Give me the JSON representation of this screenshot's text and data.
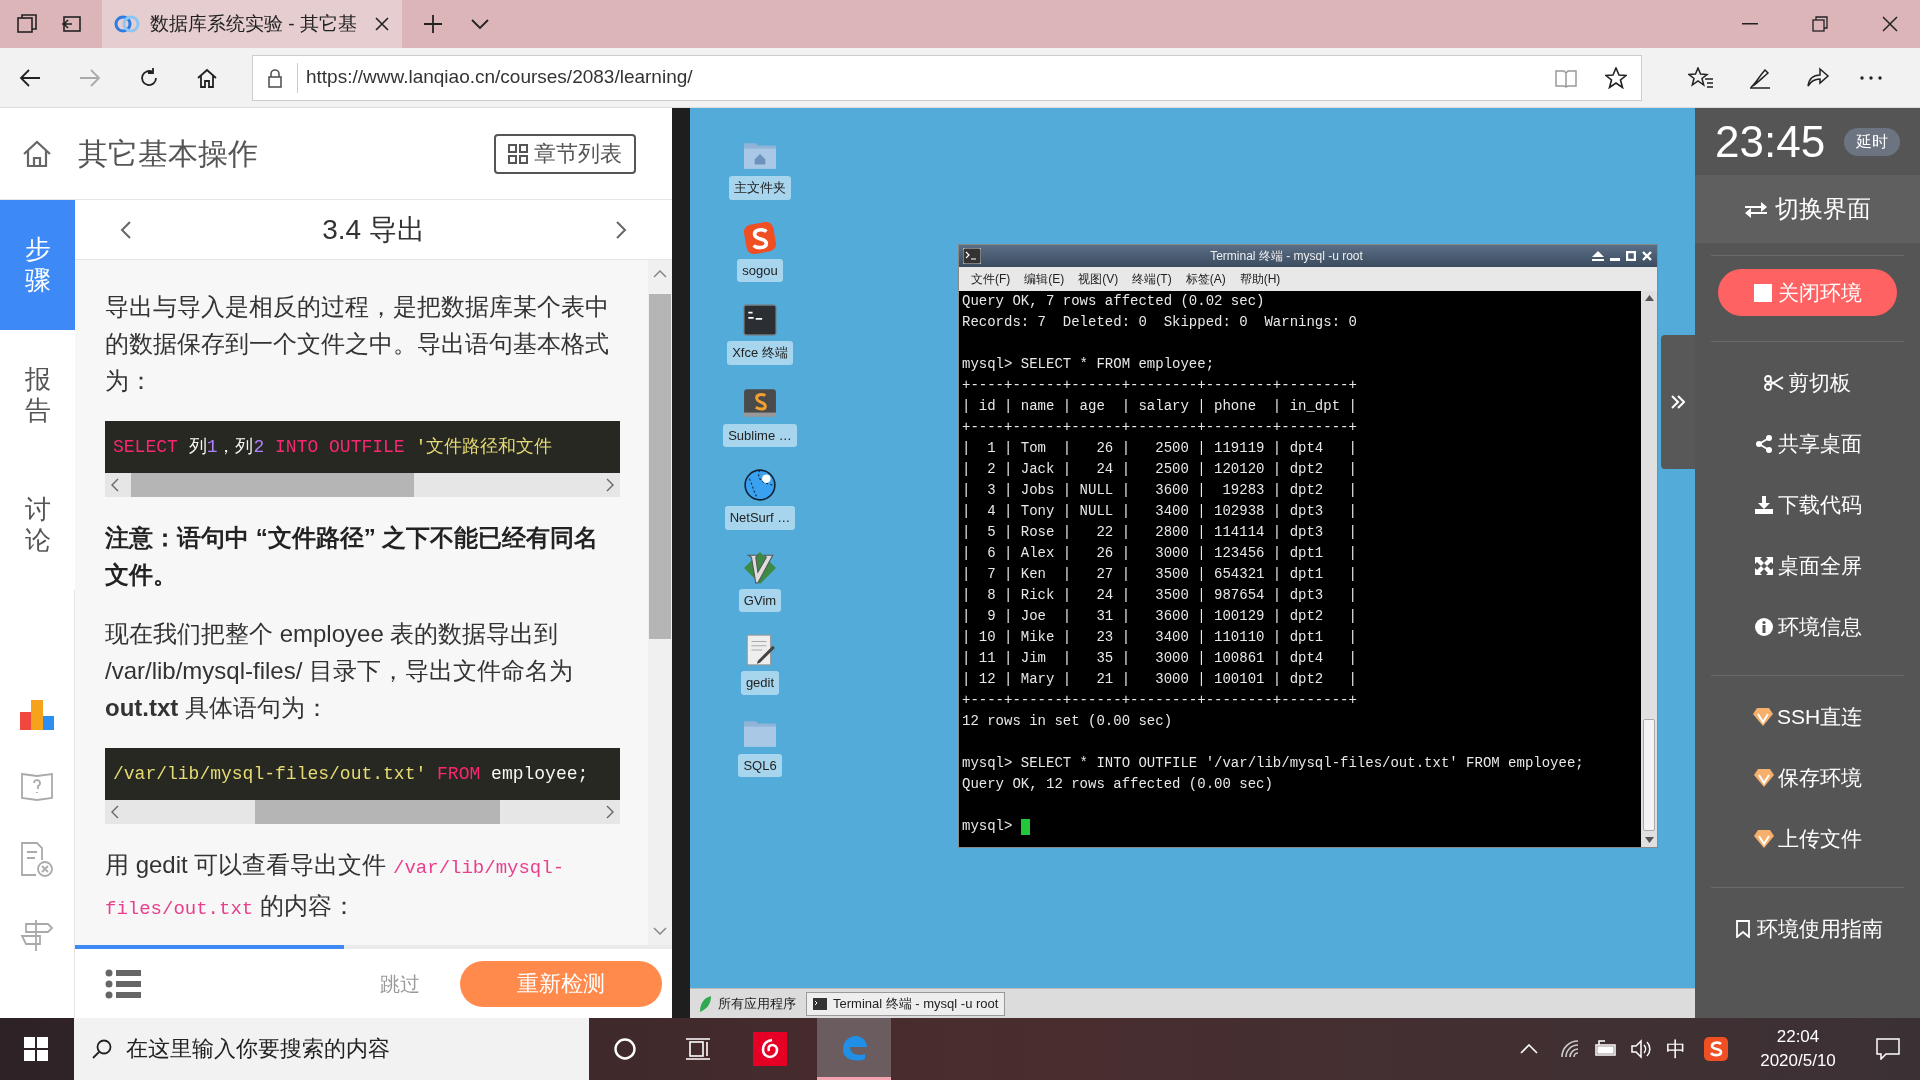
{
  "browser": {
    "tab_title": "数据库系统实验 - 其它基",
    "url": "https://www.lanqiao.cn/courses/2083/learning/"
  },
  "lesson": {
    "title": "其它基本操作",
    "chapter_button": "章节列表",
    "nav": [
      {
        "label": "步骤",
        "selected": true
      },
      {
        "label": "报告",
        "selected": false
      },
      {
        "label": "讨论",
        "selected": false
      }
    ],
    "section_title": "3.4 导出",
    "blocks": [
      {
        "kind": "paragraph",
        "text": "导出与导入是相反的过程，是把数据库某个表中的数据保存到一个文件之中。导出语句基本格式为："
      },
      {
        "kind": "code",
        "tokens": [
          {
            "kind": "keyword",
            "text": "SELECT"
          },
          {
            "kind": "text",
            "text": " 列"
          },
          {
            "kind": "number",
            "text": "1"
          },
          {
            "kind": "text",
            "text": "，列"
          },
          {
            "kind": "number",
            "text": "2"
          },
          {
            "kind": "keyword",
            "text": " INTO OUTFILE "
          },
          {
            "kind": "string",
            "text": "'文件路径和文件"
          }
        ]
      },
      {
        "kind": "note",
        "text": "注意：语句中 “文件路径” 之下不能已经有同名文件。"
      },
      {
        "kind": "paragraph",
        "text": "现在我们把整个 employee 表的数据导出到 /var/lib/mysql-files/ 目录下，导出文件命名为 **out.txt** 具体语句为："
      },
      {
        "kind": "code",
        "tokens": [
          {
            "kind": "string",
            "text": "/var/lib/mysql-files/out.txt'"
          },
          {
            "kind": "keyword",
            "text": " FROM "
          },
          {
            "kind": "text",
            "text": "employee;"
          }
        ]
      },
      {
        "kind": "mixed",
        "segments": [
          {
            "kind": "text",
            "text": "用 gedit 可以查看导出文件 "
          },
          {
            "kind": "code",
            "text": "/var/lib/mysql-files/out.txt"
          },
          {
            "kind": "text",
            "text": " 的内容："
          }
        ]
      }
    ],
    "progress": {
      "level": 0.45
    },
    "skip": "跳过",
    "recheck": "重新检测"
  },
  "desktop": {
    "icons": [
      {
        "kind": "home",
        "label": "主文件夹"
      },
      {
        "kind": "sogou",
        "label": "sogou"
      },
      {
        "kind": "terminal",
        "label": "Xfce 终端"
      },
      {
        "kind": "sublime",
        "label": "Sublime …"
      },
      {
        "kind": "globe",
        "label": "NetSurf …"
      },
      {
        "kind": "vim",
        "label": "GVim"
      },
      {
        "kind": "editor",
        "label": "gedit"
      },
      {
        "kind": "folder",
        "label": "SQL6"
      }
    ],
    "terminal": {
      "title": "Terminal 终端 - mysql -u root",
      "menu": [
        "文件(F)",
        "编辑(E)",
        "视图(V)",
        "终端(T)",
        "标签(A)",
        "帮助(H)"
      ],
      "blocks": [
        [
          "Query OK, 7 rows affected (0.02 sec)",
          "Records: 7  Deleted: 0  Skipped: 0  Warnings: 0"
        ],
        [
          "mysql> SELECT * FROM employee;",
          "+----+------+------+--------+--------+--------+",
          "| id | name | age  | salary | phone  | in_dpt |",
          "+----+------+------+--------+--------+--------+",
          "|  1 | Tom  |   26 |   2500 | 119119 | dpt4   |",
          "|  2 | Jack |   24 |   2500 | 120120 | dpt2   |",
          "|  3 | Jobs | NULL |   3600 |  19283 | dpt2   |",
          "|  4 | Tony | NULL |   3400 | 102938 | dpt3   |",
          "|  5 | Rose |   22 |   2800 | 114114 | dpt3   |",
          "|  6 | Alex |   26 |   3000 | 123456 | dpt1   |",
          "|  7 | Ken  |   27 |   3500 | 654321 | dpt1   |",
          "|  8 | Rick |   24 |   3500 | 987654 | dpt3   |",
          "|  9 | Joe  |   31 |   3600 | 100129 | dpt2   |",
          "| 10 | Mike |   23 |   3400 | 110110 | dpt1   |",
          "| 11 | Jim  |   35 |   3000 | 100861 | dpt4   |",
          "| 12 | Mary |   21 |   3000 | 100101 | dpt2   |",
          "+----+------+------+--------+--------+--------+",
          "12 rows in set (0.00 sec)"
        ],
        [
          "mysql> SELECT * INTO OUTFILE '/var/lib/mysql-files/out.txt' FROM employee;",
          "Query OK, 12 rows affected (0.00 sec)"
        ],
        [
          "mysql> "
        ]
      ],
      "cursor_visible": true
    },
    "taskbar": {
      "apps_button": "所有应用程序",
      "windows": [
        "Terminal 终端 - mysql -u root"
      ]
    }
  },
  "env_panel": {
    "time": "23:45",
    "extend": "延时",
    "switch": "切换界面",
    "close": "关闭环境",
    "groups": [
      [
        {
          "kind": "scissors",
          "label": "剪切板"
        },
        {
          "kind": "share",
          "label": "共享桌面"
        },
        {
          "kind": "download",
          "label": "下载代码"
        },
        {
          "kind": "expand",
          "label": "桌面全屏"
        },
        {
          "kind": "info",
          "label": "环境信息"
        }
      ],
      [
        {
          "kind": "gem",
          "label": "SSH直连"
        },
        {
          "kind": "gem",
          "label": "保存环境"
        },
        {
          "kind": "gem",
          "label": "上传文件"
        }
      ],
      [
        {
          "kind": "bookmark",
          "label": "环境使用指南"
        }
      ]
    ]
  },
  "windows_taskbar": {
    "search_placeholder": "在这里输入你要搜索的内容",
    "ime": "中",
    "time": "22:04",
    "date": "2020/5/10"
  }
}
